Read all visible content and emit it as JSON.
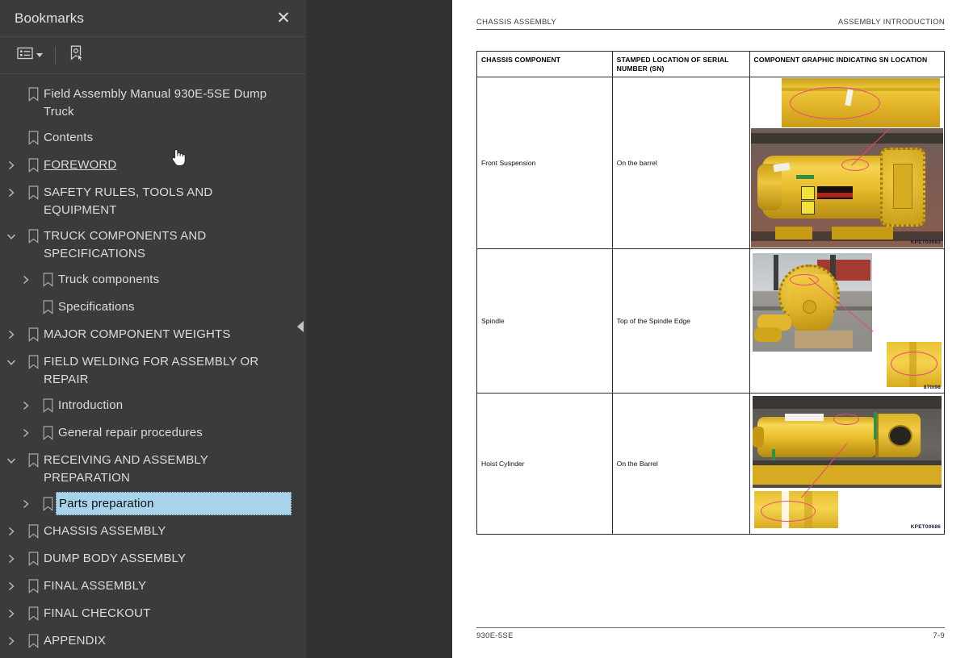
{
  "panel": {
    "title": "Bookmarks",
    "close_icon": "close-icon",
    "toolbar": {
      "options_label": "options-list-icon",
      "new_bookmark_label": "new-bookmark-icon"
    },
    "items": [
      {
        "label": "Field Assembly Manual 930E-5SE Dump Truck",
        "level": 0,
        "twisty": "none",
        "state": "normal"
      },
      {
        "label": "Contents",
        "level": 0,
        "twisty": "none",
        "state": "normal"
      },
      {
        "label": "FOREWORD",
        "level": 0,
        "twisty": "collapsed",
        "state": "hover"
      },
      {
        "label": "SAFETY RULES, TOOLS AND EQUIPMENT",
        "level": 0,
        "twisty": "collapsed",
        "state": "normal"
      },
      {
        "label": "TRUCK COMPONENTS AND SPECIFICATIONS",
        "level": 0,
        "twisty": "expanded",
        "state": "normal"
      },
      {
        "label": "Truck components",
        "level": 1,
        "twisty": "collapsed",
        "state": "normal"
      },
      {
        "label": "Specifications",
        "level": 1,
        "twisty": "none",
        "state": "normal"
      },
      {
        "label": "MAJOR COMPONENT WEIGHTS",
        "level": 0,
        "twisty": "collapsed",
        "state": "normal"
      },
      {
        "label": "FIELD WELDING FOR ASSEMBLY OR REPAIR",
        "level": 0,
        "twisty": "expanded",
        "state": "normal"
      },
      {
        "label": "Introduction",
        "level": 1,
        "twisty": "collapsed",
        "state": "normal"
      },
      {
        "label": "General repair procedures",
        "level": 1,
        "twisty": "collapsed",
        "state": "normal"
      },
      {
        "label": "RECEIVING AND ASSEMBLY PREPARATION",
        "level": 0,
        "twisty": "expanded",
        "state": "normal"
      },
      {
        "label": "Parts preparation",
        "level": 1,
        "twisty": "collapsed",
        "state": "selected"
      },
      {
        "label": "CHASSIS ASSEMBLY",
        "level": 0,
        "twisty": "collapsed",
        "state": "normal"
      },
      {
        "label": "DUMP BODY ASSEMBLY",
        "level": 0,
        "twisty": "collapsed",
        "state": "normal"
      },
      {
        "label": "FINAL ASSEMBLY",
        "level": 0,
        "twisty": "collapsed",
        "state": "normal"
      },
      {
        "label": "FINAL CHECKOUT",
        "level": 0,
        "twisty": "collapsed",
        "state": "normal"
      },
      {
        "label": "APPENDIX",
        "level": 0,
        "twisty": "collapsed",
        "state": "normal"
      }
    ],
    "collapse_handle": "collapse-panel-handle"
  },
  "document": {
    "header_left": "CHASSIS ASSEMBLY",
    "header_right": "ASSEMBLY INTRODUCTION",
    "footer_left": "930E-5SE",
    "footer_right": "7-9",
    "table": {
      "columns": [
        "CHASSIS COMPONENT",
        "STAMPED LOCATION OF SERIAL NUMBER (SN)",
        "COMPONENT GRAPHIC INDICATING SN LOCATION"
      ],
      "rows": [
        {
          "component": "Front Suspension",
          "location": "On the barrel",
          "figure_caption": "KPET00683"
        },
        {
          "component": "Spindle",
          "location": "Top of the Spindle Edge",
          "figure_caption": "870I98"
        },
        {
          "component": "Hoist Cylinder",
          "location": "On the Barrel",
          "figure_caption": "KPET00686"
        }
      ]
    }
  },
  "colors": {
    "panel_bg": "#3b3b3b",
    "viewer_bg": "#323232",
    "selection": "#a8d3ea",
    "callout": "#e8467c",
    "equipment_yellow": "#e8b91d"
  }
}
